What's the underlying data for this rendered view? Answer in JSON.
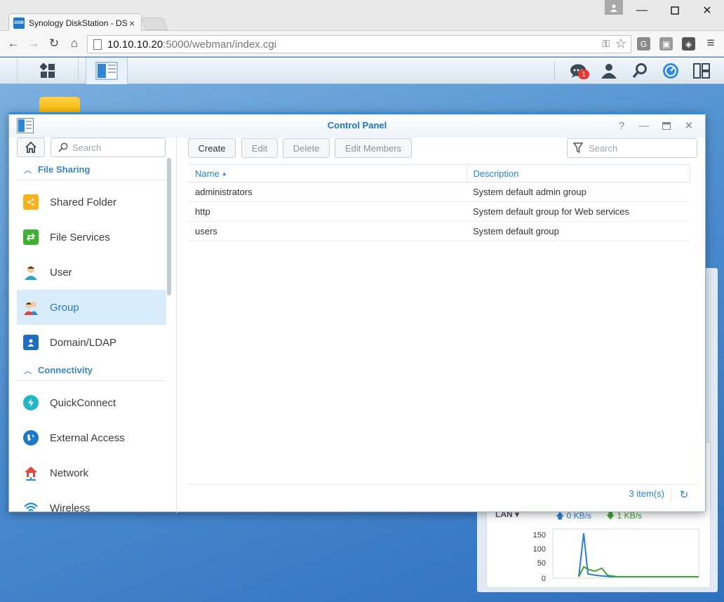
{
  "browser": {
    "tab_title": "Synology DiskStation - DS",
    "favicon_text": "DSM",
    "url_host": "10.10.10.20",
    "url_rest": ":5000/webman/index.cgi",
    "extensions": [
      "G"
    ]
  },
  "window": {
    "title": "Control Panel",
    "search_placeholder": "Search"
  },
  "sidebar": {
    "sections": [
      {
        "label": "File Sharing",
        "items": [
          {
            "label": "Shared Folder",
            "icon": "shared-folder-icon",
            "active": false
          },
          {
            "label": "File Services",
            "icon": "file-services-icon",
            "active": false
          },
          {
            "label": "User",
            "icon": "user-icon",
            "active": false
          },
          {
            "label": "Group",
            "icon": "group-icon",
            "active": true
          },
          {
            "label": "Domain/LDAP",
            "icon": "domain-ldap-icon",
            "active": false
          }
        ]
      },
      {
        "label": "Connectivity",
        "items": [
          {
            "label": "QuickConnect",
            "icon": "quickconnect-icon",
            "active": false
          },
          {
            "label": "External Access",
            "icon": "external-access-icon",
            "active": false
          },
          {
            "label": "Network",
            "icon": "network-icon",
            "active": false
          },
          {
            "label": "Wireless",
            "icon": "wireless-icon",
            "active": false
          }
        ]
      }
    ]
  },
  "toolbar": {
    "create_label": "Create",
    "edit_label": "Edit",
    "delete_label": "Delete",
    "edit_members_label": "Edit Members",
    "search_placeholder": "Search"
  },
  "grid": {
    "columns": [
      "Name",
      "Description"
    ],
    "rows": [
      {
        "name": "administrators",
        "description": "System default admin group"
      },
      {
        "name": "http",
        "description": "System default group for Web services"
      },
      {
        "name": "users",
        "description": "System default group"
      }
    ],
    "item_count": "3 item(s)"
  },
  "taskbar": {
    "notification_count": "1"
  },
  "widget": {
    "interface_label": "LAN",
    "upload": "0 KB/s",
    "download": "1 KB/s",
    "y_ticks": [
      "150",
      "100",
      "50",
      "0"
    ]
  },
  "colors": {
    "accent": "#2a82d1",
    "active_nav": "#d9ecfb",
    "upload_line": "#2a7fd4",
    "download_line": "#3aa532"
  }
}
